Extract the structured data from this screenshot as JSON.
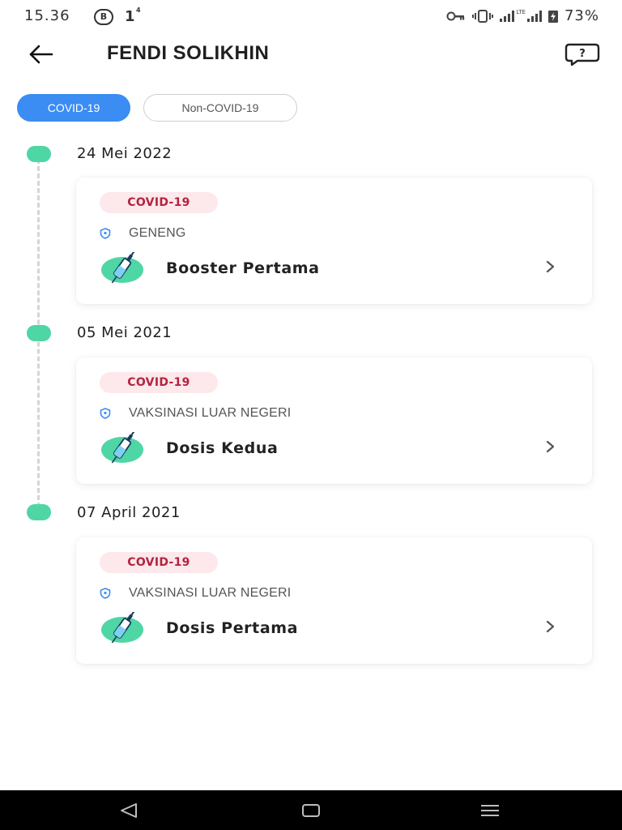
{
  "status_bar": {
    "time": "15.36",
    "badge_letter": "B",
    "notif_count": "1",
    "notif_sup": "4",
    "network_label": "LTE",
    "battery": "73%"
  },
  "header": {
    "title": "FENDI SOLIKHIN"
  },
  "tabs": [
    {
      "label": "COVID-19",
      "active": true
    },
    {
      "label": "Non-COVID-19",
      "active": false
    }
  ],
  "records": [
    {
      "date": "24 Mei 2022",
      "category": "COVID-19",
      "location": "GENENG",
      "dose": "Booster Pertama"
    },
    {
      "date": "05 Mei 2021",
      "category": "COVID-19",
      "location": "VAKSINASI LUAR NEGERI",
      "dose": "Dosis Kedua"
    },
    {
      "date": "07 April 2021",
      "category": "COVID-19",
      "location": "VAKSINASI LUAR NEGERI",
      "dose": "Dosis Pertama"
    }
  ],
  "colors": {
    "accent": "#3b8cf3",
    "timeline": "#4fd6a5",
    "badge_bg": "#fde8ec",
    "badge_text": "#b3233f"
  }
}
